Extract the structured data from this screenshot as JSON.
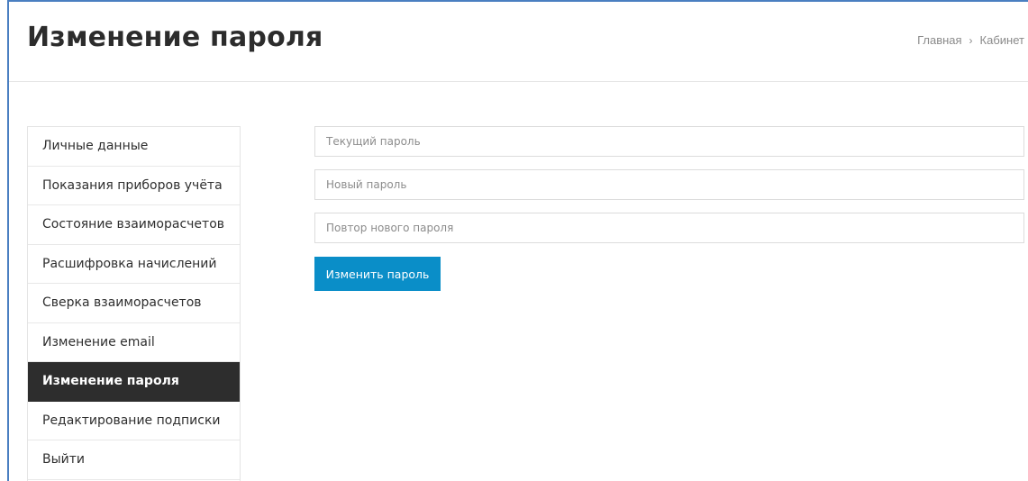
{
  "header": {
    "title": "Изменение пароля",
    "breadcrumb": {
      "home": "Главная",
      "separator": "›",
      "current": "Кабинет"
    }
  },
  "sidebar": {
    "active_index": 6,
    "items": [
      {
        "label": "Личные данные"
      },
      {
        "label": "Показания приборов учёта"
      },
      {
        "label": "Состояние взаиморасчетов"
      },
      {
        "label": "Расшифровка начислений"
      },
      {
        "label": "Сверка взаиморасчетов"
      },
      {
        "label": "Изменение email"
      },
      {
        "label": "Изменение пароля"
      },
      {
        "label": "Редактирование подписки"
      },
      {
        "label": "Выйти"
      }
    ]
  },
  "form": {
    "current_password": {
      "value": "",
      "placeholder": "Текущий пароль"
    },
    "new_password": {
      "value": "",
      "placeholder": "Новый пароль"
    },
    "repeat_password": {
      "value": "",
      "placeholder": "Повтор нового пароля"
    },
    "submit_label": "Изменить пароль"
  },
  "colors": {
    "accent": "#0a8ec8",
    "active_item_bg": "#2d2d2d",
    "frame_border": "#4a7fc1"
  }
}
